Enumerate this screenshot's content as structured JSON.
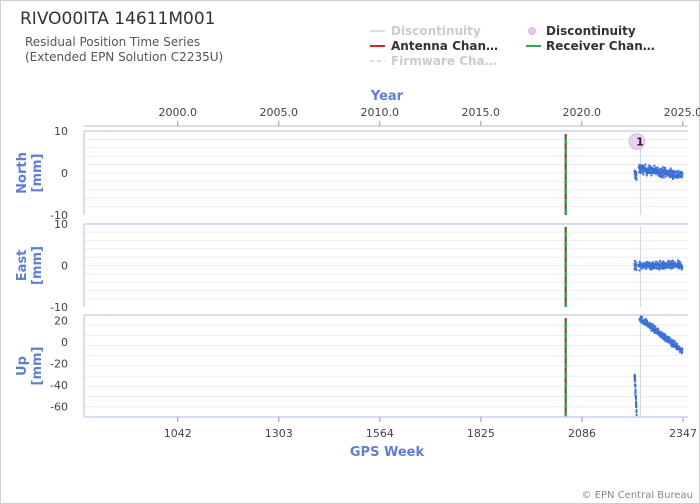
{
  "header": {
    "title": "RIVO00ITA 14611M001",
    "subtitle_line1": "Residual Position Time Series",
    "subtitle_line2": "(Extended EPN Solution C2235U)"
  },
  "legend": [
    {
      "label": "Discontinuity",
      "style": "line",
      "color": "#cccccc",
      "dimmed": true
    },
    {
      "label": "Discontinuity",
      "style": "circle",
      "color": "#e8c8f0",
      "dimmed": false
    },
    {
      "label": "Antenna Chan…",
      "style": "line",
      "color": "#e02020",
      "dimmed": false
    },
    {
      "label": "Receiver Chan…",
      "style": "line",
      "color": "#2fa84f",
      "dimmed": false
    },
    {
      "label": "Firmware Cha…",
      "style": "dashed",
      "color": "#cccccc",
      "dimmed": true
    }
  ],
  "credit": "© EPN Central Bureau",
  "colors": {
    "data": "#3a6fd8",
    "axis_title": "#5b7fd6",
    "antenna": "#e02020",
    "receiver": "#2fa84f",
    "discontinuity": "#e8c8f0"
  },
  "chart_data": {
    "type": "scatter",
    "xlabel": "GPS Week",
    "x_ticks": [
      1042,
      1303,
      1564,
      1825,
      2086,
      2347
    ],
    "x_top_label": "Year",
    "x_top_ticks": [
      "2000.0",
      "2005.0",
      "2010.0",
      "2015.0",
      "2020.0",
      "2025.0"
    ],
    "xlim": [
      800,
      2365
    ],
    "equipment_change_week": 2044,
    "discontinuity": {
      "week": 2220,
      "label": "1"
    },
    "panels": [
      {
        "name": "North",
        "ylabel_line1": "North",
        "ylabel_line2": "[mm]",
        "ylim": [
          -10,
          10
        ],
        "yticks": [
          "10",
          "0",
          "-10"
        ],
        "series": [
          {
            "x_start": 2222,
            "x_end": 2227,
            "y_start": 0,
            "y_end": -1,
            "spread": 1.2,
            "count": 25
          },
          {
            "x_start": 2233,
            "x_end": 2345,
            "y_start": 1,
            "y_end": -0.5,
            "spread": 1.3,
            "count": 260
          }
        ]
      },
      {
        "name": "East",
        "ylabel_line1": "East",
        "ylabel_line2": "[mm]",
        "ylim": [
          -10,
          10
        ],
        "yticks": [
          "10",
          "0",
          "-10"
        ],
        "series": [
          {
            "x_start": 2222,
            "x_end": 2227,
            "y_start": 0,
            "y_end": 0,
            "spread": 1.0,
            "count": 25
          },
          {
            "x_start": 2233,
            "x_end": 2345,
            "y_start": 0,
            "y_end": 0,
            "spread": 1.1,
            "count": 260
          }
        ]
      },
      {
        "name": "Up",
        "ylabel_line1": "Up",
        "ylabel_line2": "[mm]",
        "ylim": [
          -70,
          25
        ],
        "yticks": [
          "20",
          "0",
          "-20",
          "-40",
          "-60"
        ],
        "series": [
          {
            "x_start": 2222,
            "x_end": 2227,
            "y_start": -30,
            "y_end": -65,
            "spread": 5,
            "count": 40
          },
          {
            "x_start": 2235,
            "x_end": 2345,
            "y_start": 22,
            "y_end": -8,
            "spread": 3.5,
            "count": 280
          }
        ]
      }
    ]
  }
}
